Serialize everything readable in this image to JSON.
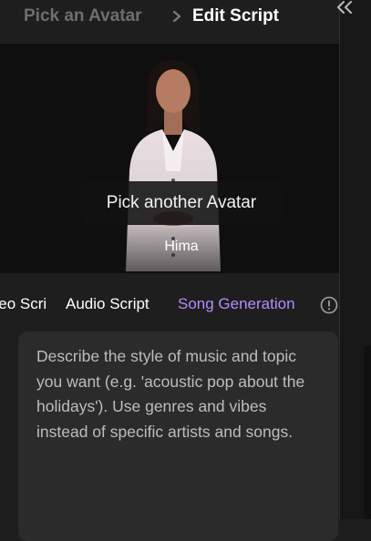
{
  "breadcrumb": {
    "previous": "Pick an Avatar",
    "current": "Edit Script",
    "separator_icon": "chevron-right-icon"
  },
  "panel": {
    "collapse_icon": "double-chevron-left-icon"
  },
  "avatar": {
    "pick_button_label": "Pick another Avatar",
    "name": "Hima"
  },
  "tabs": [
    {
      "label": "Video Script",
      "visible_text": "cript",
      "active": false
    },
    {
      "label": "Audio Script",
      "active": false
    },
    {
      "label": "Song Generation",
      "active": true
    }
  ],
  "info_icon": "info-circle-icon",
  "prompt": {
    "placeholder": "Describe the style of music and topic you want (e.g. 'acoustic pop about the holidays'). Use genres and vibes instead of specific artists and songs."
  },
  "colors": {
    "background": "#1e1e1e",
    "active_tab": "#b18cff",
    "muted_text": "#6e6e6e",
    "input_bg": "#2b2b2b"
  }
}
